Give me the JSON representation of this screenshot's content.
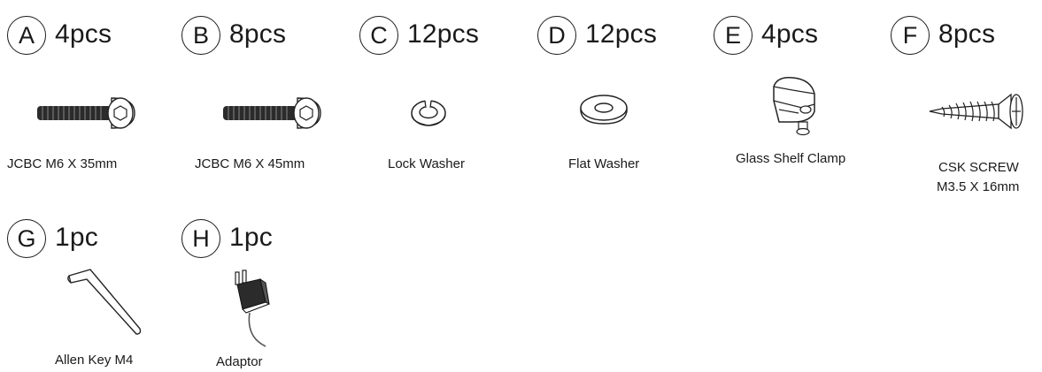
{
  "parts": [
    {
      "letter": "A",
      "qty": "4pcs",
      "name": "JCBC M6 X 35mm",
      "icon": "bolt-icon"
    },
    {
      "letter": "B",
      "qty": "8pcs",
      "name": "JCBC M6 X 45mm",
      "icon": "bolt-icon"
    },
    {
      "letter": "C",
      "qty": "12pcs",
      "name": "Lock Washer",
      "icon": "lock-washer-icon"
    },
    {
      "letter": "D",
      "qty": "12pcs",
      "name": "Flat Washer",
      "icon": "flat-washer-icon"
    },
    {
      "letter": "E",
      "qty": "4pcs",
      "name": "Glass Shelf Clamp",
      "icon": "glass-clamp-icon"
    },
    {
      "letter": "F",
      "qty": "8pcs",
      "name": "CSK SCREW",
      "name2": "M3.5 X 16mm",
      "icon": "wood-screw-icon"
    },
    {
      "letter": "G",
      "qty": "1pc",
      "name": "Allen Key M4",
      "icon": "allen-key-icon"
    },
    {
      "letter": "H",
      "qty": "1pc",
      "name": "Adaptor",
      "icon": "adaptor-icon"
    }
  ]
}
